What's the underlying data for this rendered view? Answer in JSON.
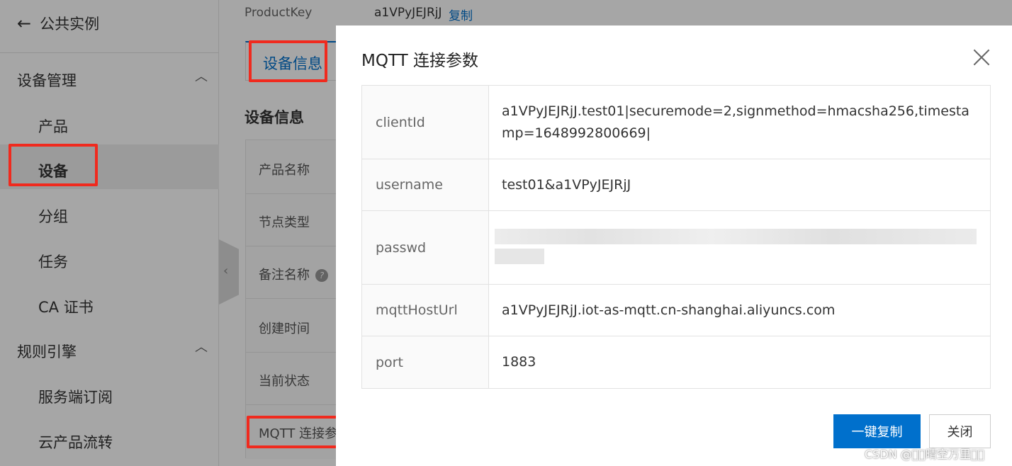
{
  "sidebar": {
    "back_label": "公共实例",
    "groups": [
      {
        "label": "设备管理",
        "items": [
          "产品",
          "设备",
          "分组",
          "任务",
          "CA 证书"
        ]
      },
      {
        "label": "规则引擎",
        "items": [
          "服务端订阅",
          "云产品流转"
        ]
      }
    ]
  },
  "page": {
    "product_key_label": "ProductKey",
    "product_key_value": "a1VPyJEJRjJ",
    "copy_link": "复制",
    "tab_device_info": "设备信息",
    "section_title": "设备信息",
    "info_rows": [
      "产品名称",
      "节点类型",
      "备注名称",
      "创建时间",
      "当前状态",
      "MQTT 连接参"
    ]
  },
  "dialog": {
    "title": "MQTT 连接参数",
    "params": [
      {
        "key": "clientId",
        "value": "a1VPyJEJRjJ.test01|securemode=2,signmethod=hmacsha256,timestamp=1648992800669|"
      },
      {
        "key": "username",
        "value": "test01&a1VPyJEJRjJ"
      },
      {
        "key": "passwd",
        "value": ""
      },
      {
        "key": "mqttHostUrl",
        "value": "a1VPyJEJRjJ.iot-as-mqtt.cn-shanghai.aliyuncs.com"
      },
      {
        "key": "port",
        "value": "1883"
      }
    ],
    "copy_all_button": "一键复制",
    "close_button": "关闭"
  },
  "watermark": "CSDN @\u0000\u0000晴空万里\u0000\u0000",
  "colors": {
    "primary": "#0070cc",
    "highlight": "#f02a1e"
  }
}
